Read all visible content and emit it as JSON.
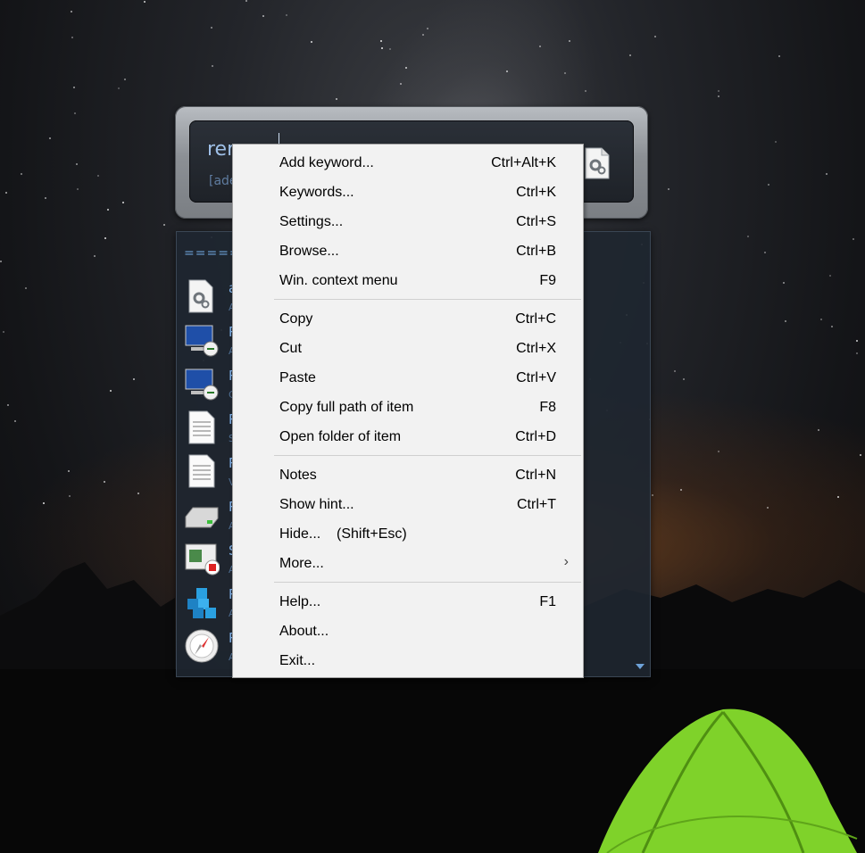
{
  "launcher": {
    "query_text": "rer",
    "hint_text": "[ade"
  },
  "results": {
    "separator": "=====",
    "items": [
      {
        "letter": "a",
        "sub": "A",
        "icon": "gear-document-icon"
      },
      {
        "letter": "R",
        "sub": "A",
        "icon": "remote-desktop-icon"
      },
      {
        "letter": "R",
        "sub": "C",
        "icon": "remote-desktop-icon"
      },
      {
        "letter": "R",
        "sub": "S",
        "icon": "text-document-icon"
      },
      {
        "letter": "R",
        "sub": "V",
        "icon": "text-document-icon"
      },
      {
        "letter": "R",
        "sub": "A",
        "icon": "drive-icon"
      },
      {
        "letter": "S",
        "sub": "A",
        "icon": "window-stop-icon"
      },
      {
        "letter": "R",
        "sub": "A",
        "icon": "registry-cubes-icon"
      },
      {
        "letter": "R",
        "sub": "A",
        "icon": "compass-icon"
      }
    ]
  },
  "context_menu": {
    "groups": [
      [
        {
          "label": "Add keyword...",
          "shortcut": "Ctrl+Alt+K"
        },
        {
          "label": "Keywords...",
          "shortcut": "Ctrl+K"
        },
        {
          "label": "Settings...",
          "shortcut": "Ctrl+S"
        },
        {
          "label": "Browse...",
          "shortcut": "Ctrl+B"
        },
        {
          "label": "Win. context menu",
          "shortcut": "F9"
        }
      ],
      [
        {
          "label": "Copy",
          "shortcut": "Ctrl+C"
        },
        {
          "label": "Cut",
          "shortcut": "Ctrl+X"
        },
        {
          "label": "Paste",
          "shortcut": "Ctrl+V"
        },
        {
          "label": "Copy full path of item",
          "shortcut": "F8"
        },
        {
          "label": "Open folder of item",
          "shortcut": "Ctrl+D"
        }
      ],
      [
        {
          "label": "Notes",
          "shortcut": "Ctrl+N"
        },
        {
          "label": "Show hint...",
          "shortcut": "Ctrl+T"
        },
        {
          "label": "Hide...    (Shift+Esc)",
          "shortcut": ""
        },
        {
          "label": "More...",
          "shortcut": "",
          "submenu": true
        }
      ],
      [
        {
          "label": "Help...",
          "shortcut": "F1"
        },
        {
          "label": "About...",
          "shortcut": ""
        },
        {
          "label": "Exit...",
          "shortcut": ""
        }
      ]
    ]
  }
}
